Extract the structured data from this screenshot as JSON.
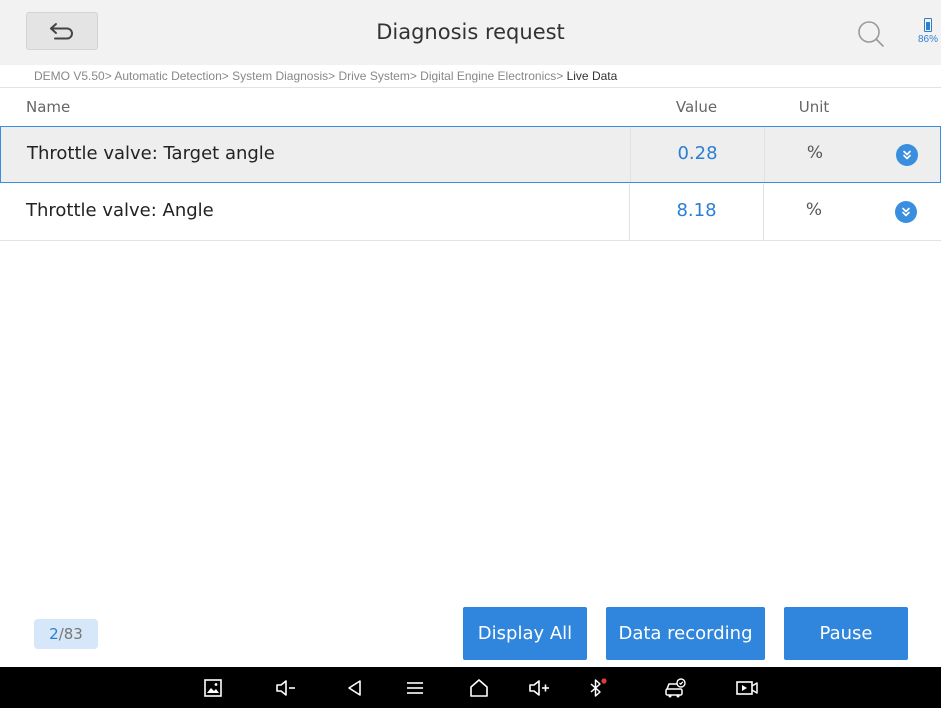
{
  "header": {
    "title": "Diagnosis request",
    "battery_percent": "86%"
  },
  "breadcrumb": {
    "path": "DEMO V5.50> Automatic Detection> System Diagnosis> Drive System> Digital Engine Electronics>",
    "current": "Live Data"
  },
  "table": {
    "columns": {
      "name": "Name",
      "value": "Value",
      "unit": "Unit"
    },
    "rows": [
      {
        "name": "Throttle valve: Target angle",
        "value": "0.28",
        "unit": "%",
        "selected": true
      },
      {
        "name": "Throttle valve: Angle",
        "value": "8.18",
        "unit": "%",
        "selected": false
      }
    ]
  },
  "pagination": {
    "current": "2",
    "separator": "/",
    "total": "83"
  },
  "buttons": {
    "display_all": "Display All",
    "data_recording": "Data recording",
    "pause": "Pause"
  },
  "navbar": {
    "icons": [
      "screenshot-icon",
      "volume-down-icon",
      "back-nav-icon",
      "menu-icon",
      "home-icon",
      "volume-up-icon",
      "bluetooth-icon",
      "car-diagnosis-icon",
      "screen-record-icon"
    ]
  },
  "colors": {
    "accent": "#2f86dc",
    "value_text": "#2a7fd4",
    "header_bg": "#f2f2f2",
    "navbar_bg": "#000000",
    "bluetooth_dot": "#e53935"
  }
}
